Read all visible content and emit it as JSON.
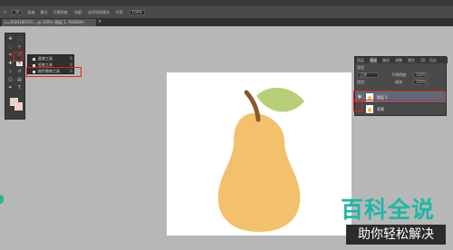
{
  "options_bar": {
    "brush_size": "30",
    "items": [
      "画笔",
      "模式",
      "不透明度:",
      "流量:",
      "启用喷枪模式",
      "平滑:",
      "100%"
    ]
  },
  "document_tab": {
    "title": "u=3026189701... @ 100% (图层 1, RGB/8#)",
    "close": "×"
  },
  "tool_flyout": {
    "items": [
      {
        "label": "画笔工具",
        "hotkey": "B"
      },
      {
        "label": "铅笔工具",
        "hotkey": "B"
      },
      {
        "label": "颜色替换工具",
        "hotkey": "B"
      }
    ]
  },
  "layers_panel": {
    "tabs": [
      "图层",
      "通道",
      "路径",
      "调整",
      "属性",
      "3D",
      "历史"
    ],
    "filter_label": "类型",
    "blend_mode": "正常",
    "opacity_label": "不透明度:",
    "opacity_value": "100%",
    "lock_label": "锁定:",
    "fill_label": "填充:",
    "fill_value": "100%",
    "layers": [
      {
        "name": "图层 1",
        "selected": true
      },
      {
        "name": "背景",
        "selected": false
      }
    ]
  },
  "watermark": {
    "title": "百科全说",
    "subtitle": "助你轻松解决"
  },
  "colors": {
    "pear": "#f3c06b",
    "leaf": "#b7cf78",
    "stem": "#8a5a2b",
    "highlight_box": "#e2231a",
    "watermark_teal": "#1db8a6"
  }
}
